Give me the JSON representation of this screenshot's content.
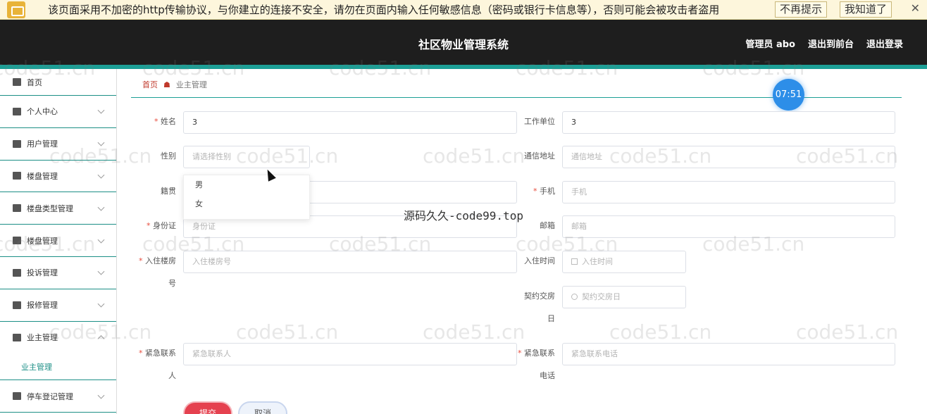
{
  "warning": {
    "text": "该页面采用不加密的http传输协议，与你建立的连接不安全，请勿在页面内输入任何敏感信息（密码或银行卡信息等），否则可能会被攻击者盗用",
    "dismiss_label": "不再提示",
    "ack_label": "我知道了",
    "close_glyph": "✕"
  },
  "header": {
    "title": "社区物业管理系统",
    "user_label": "管理员 abo",
    "frontend_link": "退出到前台",
    "logout_link": "退出登录"
  },
  "sidebar": {
    "items": [
      {
        "label": "首页",
        "icon": "home-icon"
      },
      {
        "label": "个人中心",
        "icon": "user-icon"
      },
      {
        "label": "用户管理",
        "icon": "doc-icon"
      },
      {
        "label": "楼盘管理",
        "icon": "briefcase-icon"
      },
      {
        "label": "楼盘类型管理",
        "icon": "chart-icon"
      },
      {
        "label": "楼盘管理",
        "icon": "doc-icon"
      },
      {
        "label": "投诉管理",
        "icon": "bar-icon"
      },
      {
        "label": "报修管理",
        "icon": "chat-icon"
      },
      {
        "label": "业主管理",
        "icon": "grid-icon"
      },
      {
        "label": "停车登记管理",
        "icon": "chat-icon"
      }
    ],
    "sub_item": "业主管理"
  },
  "breadcrumb": {
    "home": "首页",
    "current": "业主管理"
  },
  "timer": "07:51",
  "form": {
    "name": {
      "label": "姓名",
      "value": "3"
    },
    "workplace": {
      "label": "工作单位",
      "value": "3"
    },
    "gender": {
      "label": "性别",
      "placeholder": "请选择性别",
      "options": [
        "男",
        "女"
      ]
    },
    "address": {
      "label": "通信地址",
      "placeholder": "通信地址"
    },
    "native": {
      "label": "籍贯"
    },
    "phone": {
      "label": "手机",
      "placeholder": "手机"
    },
    "idcard": {
      "label": "身份证",
      "placeholder": "身份证"
    },
    "email": {
      "label": "邮箱",
      "placeholder": "邮箱"
    },
    "room_label_1": "入住楼房",
    "room_label_2": "号",
    "room_placeholder": "入住楼房号",
    "checkin": {
      "label": "入住时间",
      "placeholder": "入住时间"
    },
    "handover_label_1": "契约交房",
    "handover_label_2": "日",
    "handover_placeholder": "契约交房日",
    "emergency_label_1": "紧急联系",
    "emergency_label_2": "人",
    "emergency_placeholder": "紧急联系人",
    "emergency_phone_label_1": "紧急联系",
    "emergency_phone_label_2": "电话",
    "emergency_phone_placeholder": "紧急联系电话",
    "submit": "提交",
    "cancel": "取消"
  },
  "watermarks": {
    "code51": "code51.cn",
    "center": "源码久久-code99.top"
  }
}
